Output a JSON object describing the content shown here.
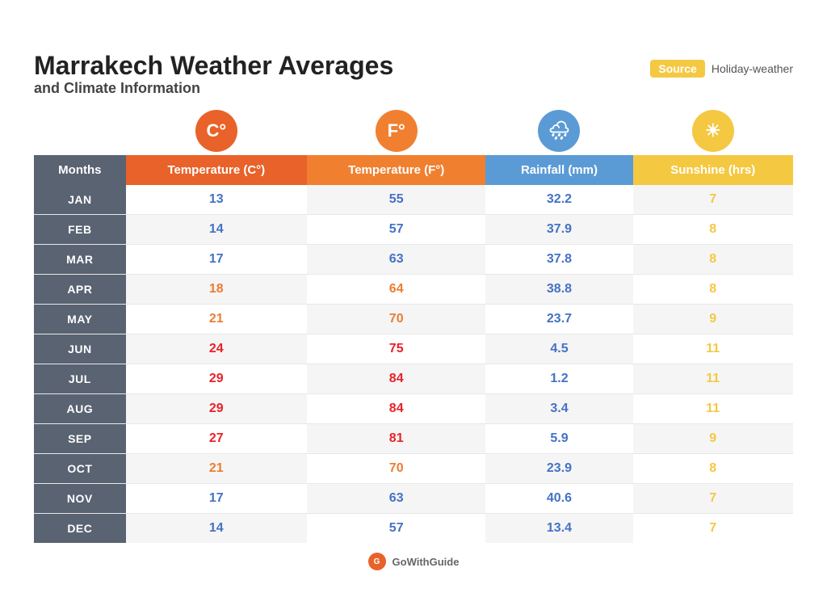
{
  "header": {
    "main_title": "Marrakech Weather Averages",
    "sub_title": "and Climate Information",
    "source_label": "Source",
    "source_name": "Holiday-weather"
  },
  "columns": {
    "months_label": "Months",
    "temp_c_label": "Temperature (C°)",
    "temp_f_label": "Temperature (F°)",
    "rain_label": "Rainfall (mm)",
    "sun_label": "Sunshine (hrs)",
    "temp_c_icon": "C°",
    "temp_f_icon": "F°",
    "rain_icon": "🌧",
    "sun_icon": "☀"
  },
  "rows": [
    {
      "month": "JAN",
      "temp_c": "13",
      "temp_f": "55",
      "rain": "32.2",
      "sun": "7",
      "temp_class": "cold"
    },
    {
      "month": "FEB",
      "temp_c": "14",
      "temp_f": "57",
      "rain": "37.9",
      "sun": "8",
      "temp_class": "cold"
    },
    {
      "month": "MAR",
      "temp_c": "17",
      "temp_f": "63",
      "rain": "37.8",
      "sun": "8",
      "temp_class": "cold"
    },
    {
      "month": "APR",
      "temp_c": "18",
      "temp_f": "64",
      "rain": "38.8",
      "sun": "8",
      "temp_class": "warm"
    },
    {
      "month": "MAY",
      "temp_c": "21",
      "temp_f": "70",
      "rain": "23.7",
      "sun": "9",
      "temp_class": "warm"
    },
    {
      "month": "JUN",
      "temp_c": "24",
      "temp_f": "75",
      "rain": "4.5",
      "sun": "11",
      "temp_class": "hot"
    },
    {
      "month": "JUL",
      "temp_c": "29",
      "temp_f": "84",
      "rain": "1.2",
      "sun": "11",
      "temp_class": "hot"
    },
    {
      "month": "AUG",
      "temp_c": "29",
      "temp_f": "84",
      "rain": "3.4",
      "sun": "11",
      "temp_class": "hot"
    },
    {
      "month": "SEP",
      "temp_c": "27",
      "temp_f": "81",
      "rain": "5.9",
      "sun": "9",
      "temp_class": "hot"
    },
    {
      "month": "OCT",
      "temp_c": "21",
      "temp_f": "70",
      "rain": "23.9",
      "sun": "8",
      "temp_class": "warm"
    },
    {
      "month": "NOV",
      "temp_c": "17",
      "temp_f": "63",
      "rain": "40.6",
      "sun": "7",
      "temp_class": "cold"
    },
    {
      "month": "DEC",
      "temp_c": "14",
      "temp_f": "57",
      "rain": "13.4",
      "sun": "7",
      "temp_class": "cold"
    }
  ],
  "footer": {
    "brand": "GoWithGuide"
  },
  "colors": {
    "cold": "#4472c4",
    "warm": "#ed7d31",
    "hot": "#e8222a",
    "rain_blue": "#4472c4",
    "sun_yellow": "#f5c842"
  }
}
